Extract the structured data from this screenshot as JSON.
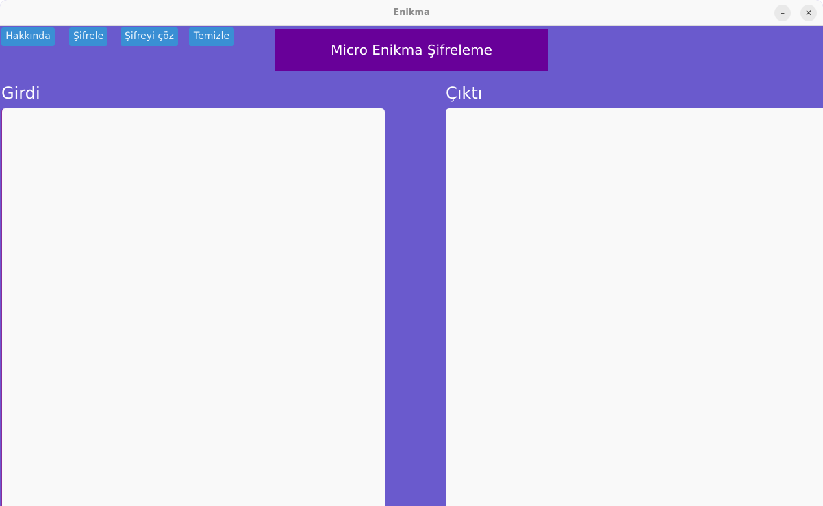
{
  "window": {
    "title": "Enikma",
    "minimize_label": "–",
    "close_label": "✕",
    "background_color": "#6a5acd"
  },
  "toolbar": {
    "about_label": "Hakkında",
    "encrypt_label": "Şifrele",
    "decrypt_label": "Şifreyi çöz",
    "clear_label": "Temizle",
    "button_color": "#3a8fd4"
  },
  "banner": {
    "text": "Micro Enikma Şifreleme",
    "color": "#680099"
  },
  "input_panel": {
    "label": "Girdi",
    "value": ""
  },
  "output_panel": {
    "label": "Çıktı",
    "value": ""
  }
}
